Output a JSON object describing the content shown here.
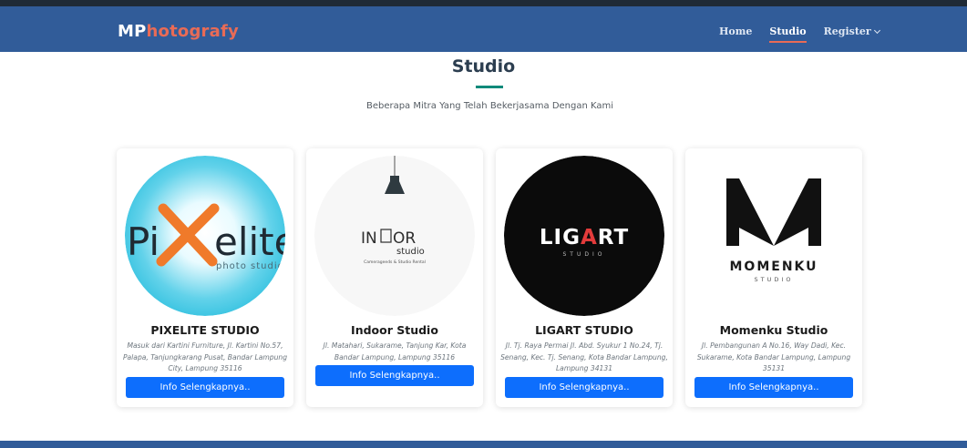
{
  "brand": {
    "part1": "MP",
    "part2": "hotografy"
  },
  "nav": {
    "home": "Home",
    "studio": "Studio",
    "register": "Register"
  },
  "section": {
    "title": "Studio",
    "subtitle": "Beberapa Mitra Yang Telah Bekerjasama Dengan Kami"
  },
  "studios": [
    {
      "name": "PIXELITE STUDIO",
      "address": "Masuk dari Kartini Furniture, Jl. Kartini No.57, Palapa, Tanjungkarang Pusat, Bandar Lampung City, Lampung 35116",
      "button": "Info Selengkapnya..",
      "logo_text": "Pi elite",
      "logo_sub": "photo studio"
    },
    {
      "name": "Indoor Studio",
      "address": "Jl. Matahari, Sukarame, Tanjung Kar, Kota Bandar Lampung, Lampung 35116",
      "button": "Info Selengkapnya..",
      "logo_text": "INDOOR",
      "logo_sub": "studio",
      "logo_tagline": "Camerageeds & Studio Rental"
    },
    {
      "name": "LIGART STUDIO",
      "address": "Jl. Tj. Raya Permai Jl. Abd. Syukur 1 No.24, Tj. Senang, Kec. Tj. Senang, Kota Bandar Lampung, Lampung 34131",
      "button": "Info Selengkapnya..",
      "logo_text": "LIGART",
      "logo_sub": "STUDIO"
    },
    {
      "name": "Momenku Studio",
      "address": "Jl. Pembangunan A No.16, Way Dadi, Kec. Sukarame, Kota Bandar Lampung, Lampung 35131",
      "button": "Info Selengkapnya..",
      "logo_text": "MOMENKU",
      "logo_sub": "STUDIO"
    }
  ],
  "colors": {
    "navbar": "#315c99",
    "brand_accent": "#e96b56",
    "title_underline": "#0e8a7a",
    "button": "#0d6efd"
  }
}
